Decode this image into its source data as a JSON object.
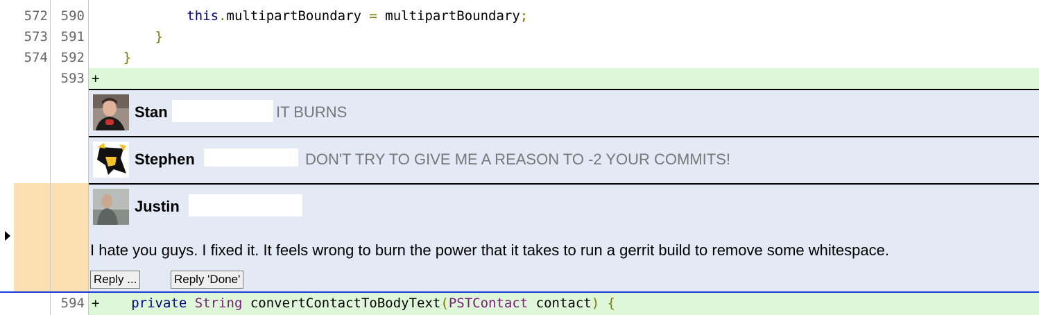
{
  "diff": {
    "lines": [
      {
        "old": "572",
        "new": "590",
        "indent": "            ",
        "code": [
          {
            "t": "this",
            "c": "kw"
          },
          {
            "t": ".",
            "c": "pu"
          },
          {
            "t": "multipartBoundary "
          },
          {
            "t": "=",
            "c": "pu"
          },
          {
            "t": " multipartBoundary"
          },
          {
            "t": ";",
            "c": "pu"
          }
        ]
      },
      {
        "old": "573",
        "new": "591",
        "indent": "        ",
        "code": [
          {
            "t": "}",
            "c": "pu"
          }
        ]
      },
      {
        "old": "574",
        "new": "592",
        "indent": "    ",
        "code": [
          {
            "t": "}",
            "c": "pu"
          }
        ]
      }
    ],
    "added_593": {
      "new": "593",
      "marker": "+"
    },
    "added_594": {
      "new": "594",
      "marker": "+"
    }
  },
  "comments": [
    {
      "author": "Stan",
      "summary": "IT BURNS"
    },
    {
      "author": "Stephen",
      "summary": "DON'T TRY TO GIVE ME A REASON TO -2 YOUR COMMITS!"
    },
    {
      "author": "Justin",
      "message": "I hate you guys. I fixed it. It feels wrong to burn the power that it takes to run a gerrit build to remove some whitespace.",
      "reply_label": "Reply ...",
      "reply_done_label": "Reply 'Done'"
    }
  ],
  "line594": {
    "indent": "    ",
    "kw": "private",
    "type1": "String",
    "method": " convertContactToBodyText",
    "paren_open": "(",
    "type2": "PSTContact",
    "arg": " contact",
    "paren_close": ")",
    "brace": " {"
  },
  "colors": {
    "added_bg": "#dff7d9",
    "comment_bg": "#e4e9f6",
    "expanded_gutter": "#fde0b2",
    "active_rule": "#1a3fd6"
  }
}
